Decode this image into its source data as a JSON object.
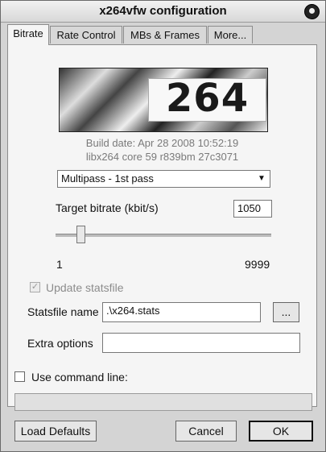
{
  "window": {
    "title": "x264vfw configuration"
  },
  "tabs": [
    {
      "label": "Bitrate"
    },
    {
      "label": "Rate Control"
    },
    {
      "label": "MBs & Frames"
    },
    {
      "label": "More..."
    }
  ],
  "logo": {
    "text": "264"
  },
  "build": {
    "date": "Build date: Apr 28 2008 10:52:19",
    "core": "libx264 core 59 r839bm 27c3071"
  },
  "mode": {
    "selected": "Multipass - 1st pass"
  },
  "bitrate": {
    "label": "Target bitrate (kbit/s)",
    "value": "1050",
    "min": "1",
    "max": "9999"
  },
  "stats": {
    "update_label": "Update statsfile",
    "file_label": "Statsfile name",
    "file_value": ".\\x264.stats",
    "browse_label": "..."
  },
  "extra": {
    "label": "Extra options",
    "value": ""
  },
  "cmdline": {
    "label": "Use command line:",
    "value": ""
  },
  "buttons": {
    "load_defaults": "Load Defaults",
    "cancel": "Cancel",
    "ok": "OK"
  }
}
